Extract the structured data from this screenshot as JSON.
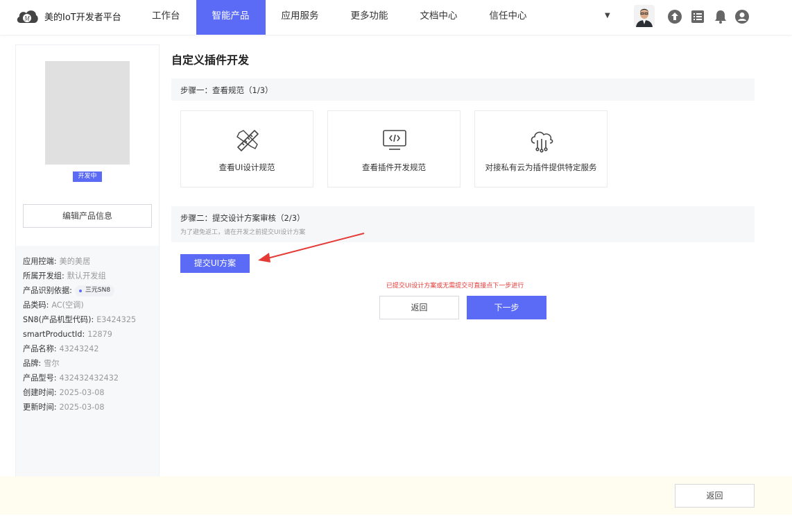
{
  "brand": {
    "name": "美的IoT开发者平台",
    "logo_letter": "M"
  },
  "nav": {
    "items": [
      {
        "label": "工作台",
        "active": false
      },
      {
        "label": "智能产品",
        "active": true
      },
      {
        "label": "应用服务",
        "active": false
      },
      {
        "label": "更多功能",
        "active": false
      },
      {
        "label": "文档中心",
        "active": false
      },
      {
        "label": "信任中心",
        "active": false
      }
    ],
    "dropdown_glyph": "▼",
    "icons": [
      "avatar",
      "upload-icon",
      "list-icon",
      "bell-icon",
      "user-icon"
    ]
  },
  "sidebar": {
    "status_badge": "开发中",
    "edit_button": "编辑产品信息",
    "info": [
      {
        "label": "应用控端:",
        "value": "美的美居"
      },
      {
        "label": "所属开发组:",
        "value": "默认开发组"
      },
      {
        "label": "产品识别依据:",
        "value": "三元SN8",
        "tag": true
      },
      {
        "label": "品类码:",
        "value": "AC(空调)"
      },
      {
        "label": "SN8(产品机型代码):",
        "value": "E3424325"
      },
      {
        "label": "smartProductId:",
        "value": "12879"
      },
      {
        "label": "产品名称:",
        "value": "43243242"
      },
      {
        "label": "品牌:",
        "value": "雪尔"
      },
      {
        "label": "产品型号:",
        "value": "432432432432"
      },
      {
        "label": "创建时间:",
        "value": "2025-03-08"
      },
      {
        "label": "更新时间:",
        "value": "2025-03-08"
      }
    ]
  },
  "main": {
    "title": "自定义插件开发",
    "step1": {
      "title": "步骤一：查看规范（1/3）",
      "cards": [
        {
          "label": "查看UI设计规范",
          "icon": "ruler-pencil-icon"
        },
        {
          "label": "查看插件开发规范",
          "icon": "code-monitor-icon"
        },
        {
          "label": "对接私有云为插件提供特定服务",
          "icon": "cloud-network-icon"
        }
      ]
    },
    "step2": {
      "title": "步骤二：提交设计方案审核（2/3）",
      "subtitle": "为了避免返工，请在开发之前提交UI设计方案",
      "submit_button": "提交UI方案"
    },
    "hint": "已提交UI设计方案或无需提交可直接点下一步进行",
    "back_button": "返回",
    "next_button": "下一步"
  },
  "footer": {
    "back_button": "返回"
  },
  "colors": {
    "accent": "#5b6bf5",
    "hint": "#e53935",
    "footer_bg": "#fffcf0"
  }
}
